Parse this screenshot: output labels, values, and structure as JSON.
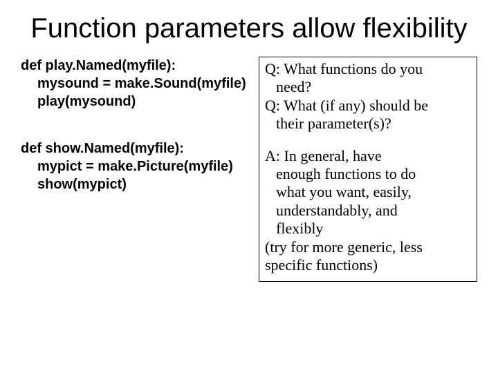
{
  "title": "Function parameters allow flexibility",
  "code": {
    "block1": {
      "l1": "def play.Named(myfile):",
      "l2": "mysound = make.Sound(myfile)",
      "l3": "play(mysound)"
    },
    "block2": {
      "l1": "def show.Named(myfile):",
      "l2": "mypict = make.Picture(myfile)",
      "l3": "show(mypict)"
    }
  },
  "qa": {
    "q1a": "Q: What functions do you",
    "q1b": "need?",
    "q2a": "Q: What (if any) should be",
    "q2b": "their parameter(s)?",
    "a1a": "A: In general, have",
    "a1b": "enough functions to do",
    "a1c": "what you want, easily,",
    "a1d": "understandably, and",
    "a1e": "flexibly",
    "a2a": "(try for more generic, less",
    "a2b": "specific functions)"
  }
}
